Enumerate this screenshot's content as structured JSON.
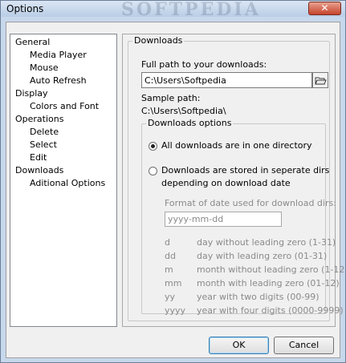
{
  "window": {
    "title": "Options",
    "watermark": "SOFTPEDIA",
    "close_label": "✕"
  },
  "tree": {
    "items": [
      {
        "label": "General",
        "level": 0
      },
      {
        "label": "Media Player",
        "level": 1
      },
      {
        "label": "Mouse",
        "level": 1
      },
      {
        "label": "Auto Refresh",
        "level": 1
      },
      {
        "label": "Display",
        "level": 0
      },
      {
        "label": "Colors and Font",
        "level": 1
      },
      {
        "label": "Operations",
        "level": 0
      },
      {
        "label": "Delete",
        "level": 1
      },
      {
        "label": "Select",
        "level": 1
      },
      {
        "label": "Edit",
        "level": 1
      },
      {
        "label": "Downloads",
        "level": 0
      },
      {
        "label": "Aditional Options",
        "level": 1
      }
    ]
  },
  "downloads": {
    "group_title": "Downloads",
    "path_label": "Full path to your downloads:",
    "path_value": "C:\\Users\\Softpedia",
    "sample_label": "Sample path:",
    "sample_value": "C:\\Users\\Softpedia\\",
    "options_title": "Downloads options",
    "radio1_label": "All downloads are in one directory",
    "radio1_checked": true,
    "radio2_line1": "Downloads are stored in seperate dirs",
    "radio2_line2": "depending on download date",
    "radio2_checked": false,
    "format_label": "Format of date used for download dirs:",
    "format_value": "yyyy-mm-dd",
    "formats": [
      {
        "code": "d",
        "desc": "day without leading zero (1-31)"
      },
      {
        "code": "dd",
        "desc": "day with leading zero (01-31)"
      },
      {
        "code": "m",
        "desc": "month without leading zero (1-12"
      },
      {
        "code": "mm",
        "desc": "month with leading zero (01-12)"
      },
      {
        "code": "yy",
        "desc": "year with two digits (00-99)"
      },
      {
        "code": "yyyy",
        "desc": "year with four digits (0000-9999)"
      }
    ]
  },
  "buttons": {
    "ok": "OK",
    "cancel": "Cancel"
  }
}
